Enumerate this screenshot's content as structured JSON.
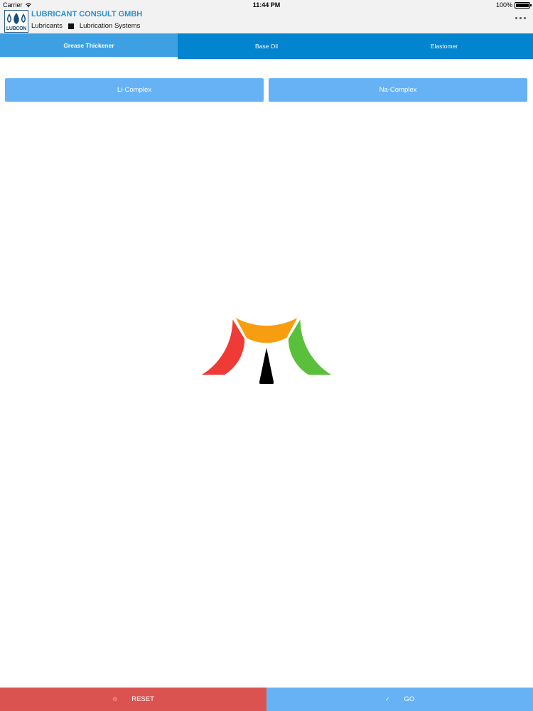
{
  "status_bar": {
    "carrier": "Carrier",
    "time": "11:44 PM",
    "battery": "100%",
    "battery_level": 1.0
  },
  "header": {
    "logo_text": "LUBCON",
    "company_name": "LUBRICANT CONSULT GMBH",
    "sub_left": "Lubricants",
    "sub_right": "Lubrication Systems"
  },
  "tabs": [
    {
      "label": "Grease Thickener",
      "active": true
    },
    {
      "label": "Base Oil",
      "active": false
    },
    {
      "label": "Elastomer",
      "active": false
    }
  ],
  "options": {
    "left_label": "Li-Complex",
    "right_label": "Na-Complex"
  },
  "gauge": {
    "segments": [
      {
        "color": "#f03a36"
      },
      {
        "color": "#f99d10"
      },
      {
        "color": "#5abf3a"
      }
    ],
    "needle_color": "#000000",
    "value": 0.5
  },
  "bottom": {
    "reset_label": "RESET",
    "go_label": "GO",
    "reset_color": "#db5350",
    "go_color": "#67b2f4"
  },
  "icons": {
    "reset": "reset-icon",
    "go": "check-icon",
    "wifi": "wifi-icon",
    "more": "more-icon"
  }
}
